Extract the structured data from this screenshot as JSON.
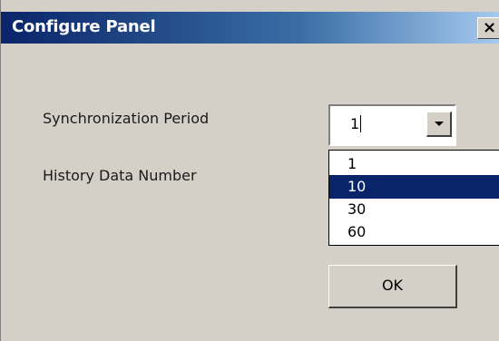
{
  "window": {
    "title": "Configure Panel",
    "close_glyph": "×",
    "titlebar_color_start": "#0a246a",
    "titlebar_color_end": "#a6caf0",
    "background": "#d4d0c8"
  },
  "form": {
    "sync_period_label": "Synchronization Period",
    "history_label": "History Data Number",
    "sync_period_value": "1"
  },
  "dropdown": {
    "options": [
      "1",
      "10",
      "30",
      "60"
    ],
    "highlighted": "10",
    "highlight_color": "#0a246a"
  },
  "actions": {
    "ok_label": "OK"
  },
  "icons": {
    "close": "close-icon",
    "dropdown_arrow": "chevron-down-icon"
  }
}
